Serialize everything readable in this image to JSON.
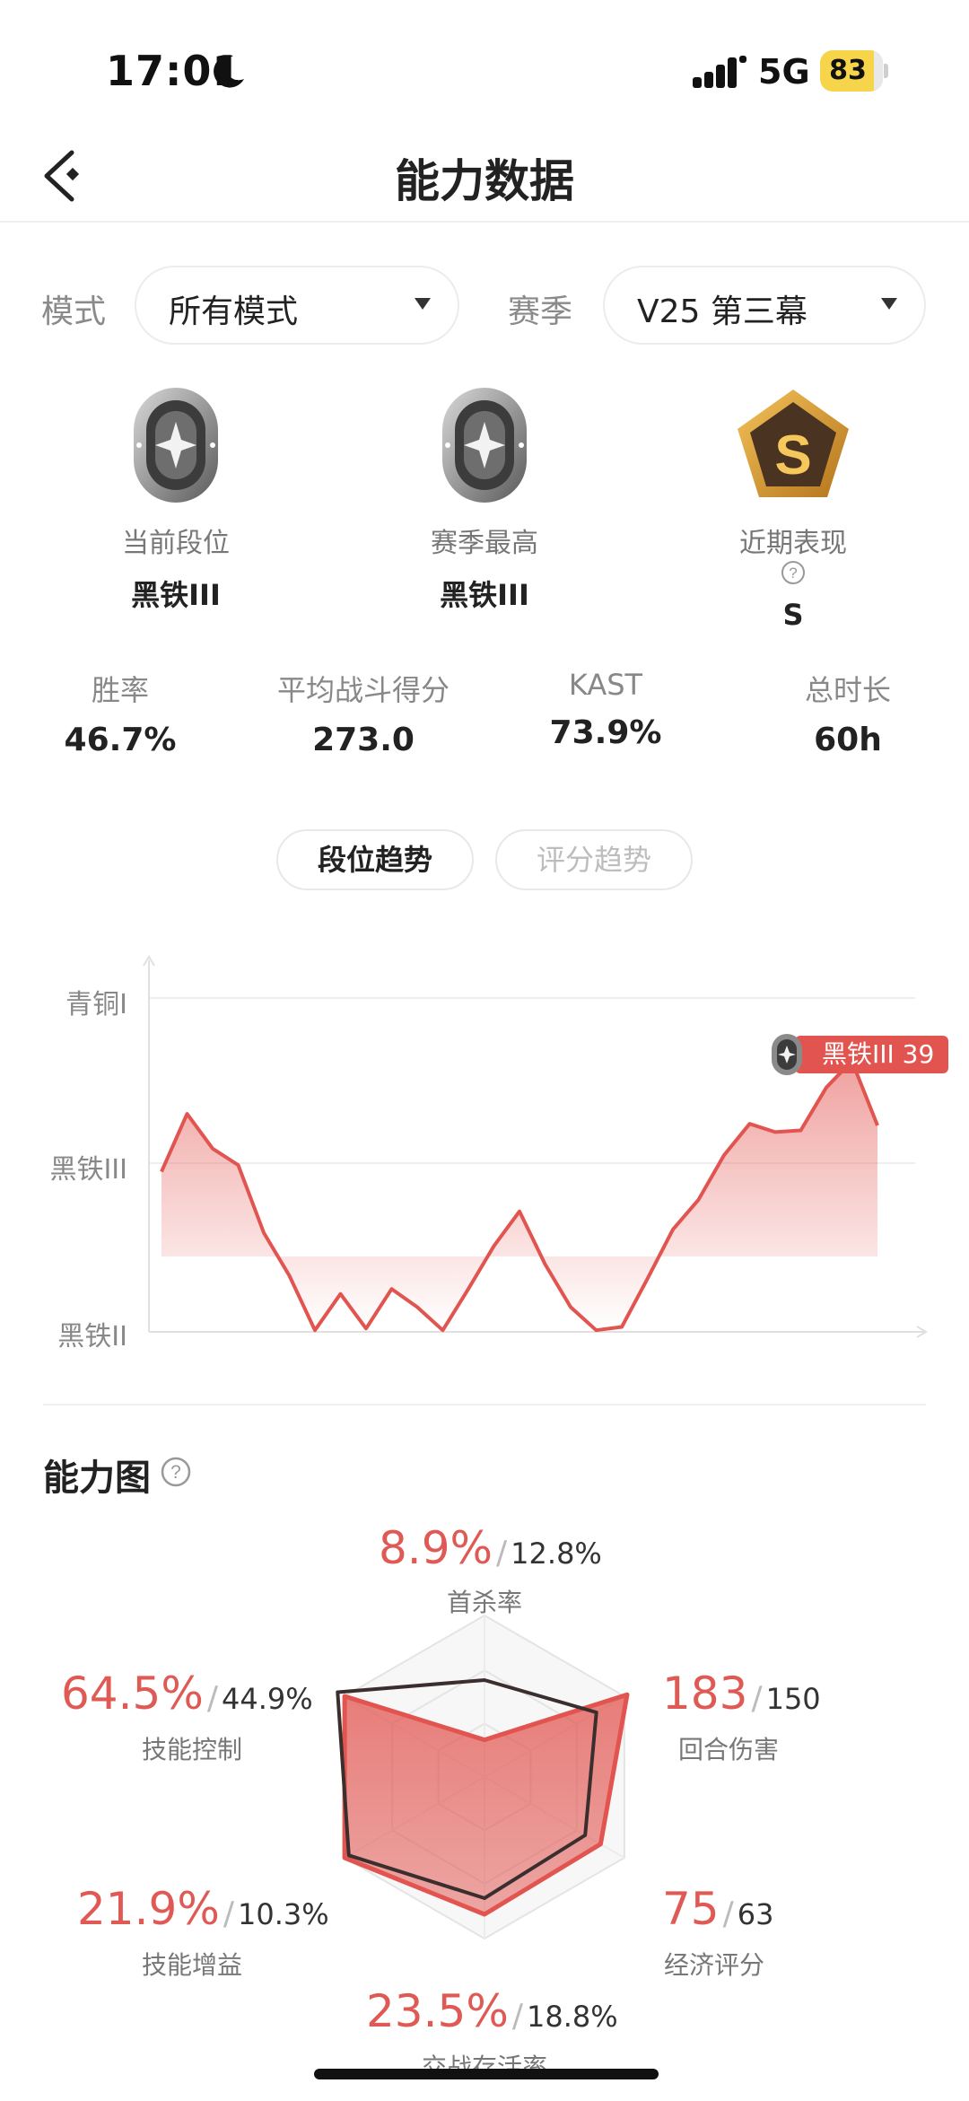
{
  "status_bar": {
    "time": "17:01",
    "network": "5G",
    "battery": "83"
  },
  "header": {
    "title": "能力数据"
  },
  "filters": {
    "mode_label": "模式",
    "mode_value": "所有模式",
    "season_label": "赛季",
    "season_value": "V25 第三幕"
  },
  "ranks": [
    {
      "label": "当前段位",
      "value": "黑铁III"
    },
    {
      "label": "赛季最高",
      "value": "黑铁III"
    },
    {
      "label": "近期表现",
      "value": "S",
      "badge_letter": "S"
    }
  ],
  "stats": [
    {
      "label": "胜率",
      "value": "46.7%"
    },
    {
      "label": "平均战斗得分",
      "value": "273.0"
    },
    {
      "label": "KAST",
      "value": "73.9%"
    },
    {
      "label": "总时长",
      "value": "60h"
    }
  ],
  "tabs": [
    {
      "label": "段位趋势",
      "active": true
    },
    {
      "label": "评分趋势",
      "active": false
    }
  ],
  "chart_data": {
    "type": "area",
    "y_categories": [
      "黑铁II",
      "黑铁III",
      "青铜I"
    ],
    "values": [
      0.97,
      1.32,
      1.11,
      1.01,
      0.6,
      0.34,
      0.01,
      0.23,
      0.02,
      0.26,
      0.15,
      0.01,
      0.26,
      0.52,
      0.73,
      0.41,
      0.15,
      0.01,
      0.03,
      0.32,
      0.62,
      0.8,
      1.07,
      1.26,
      1.21,
      1.22,
      1.48,
      1.64,
      1.25
    ],
    "last_point_label": "黑铁III 39",
    "color": "#e2544f"
  },
  "ability": {
    "title": "能力图",
    "metrics": [
      {
        "key": "first_kill",
        "value": "8.9%",
        "avg": "12.8%",
        "label": "首杀率"
      },
      {
        "key": "round_damage",
        "value": "183",
        "avg": "150",
        "label": "回合伤害"
      },
      {
        "key": "economy",
        "value": "75",
        "avg": "63",
        "label": "经济评分"
      },
      {
        "key": "survival",
        "value": "23.5%",
        "avg": "18.8%",
        "label": "交战存活率"
      },
      {
        "key": "skill_buff",
        "value": "21.9%",
        "avg": "10.3%",
        "label": "技能增益"
      },
      {
        "key": "skill_control",
        "value": "64.5%",
        "avg": "44.9%",
        "label": "技能控制"
      }
    ],
    "radar": {
      "player": [
        0.23,
        1.02,
        0.83,
        0.85,
        1.0,
        1.0
      ],
      "average": [
        0.6,
        0.8,
        0.72,
        0.75,
        0.97,
        1.05
      ]
    }
  }
}
